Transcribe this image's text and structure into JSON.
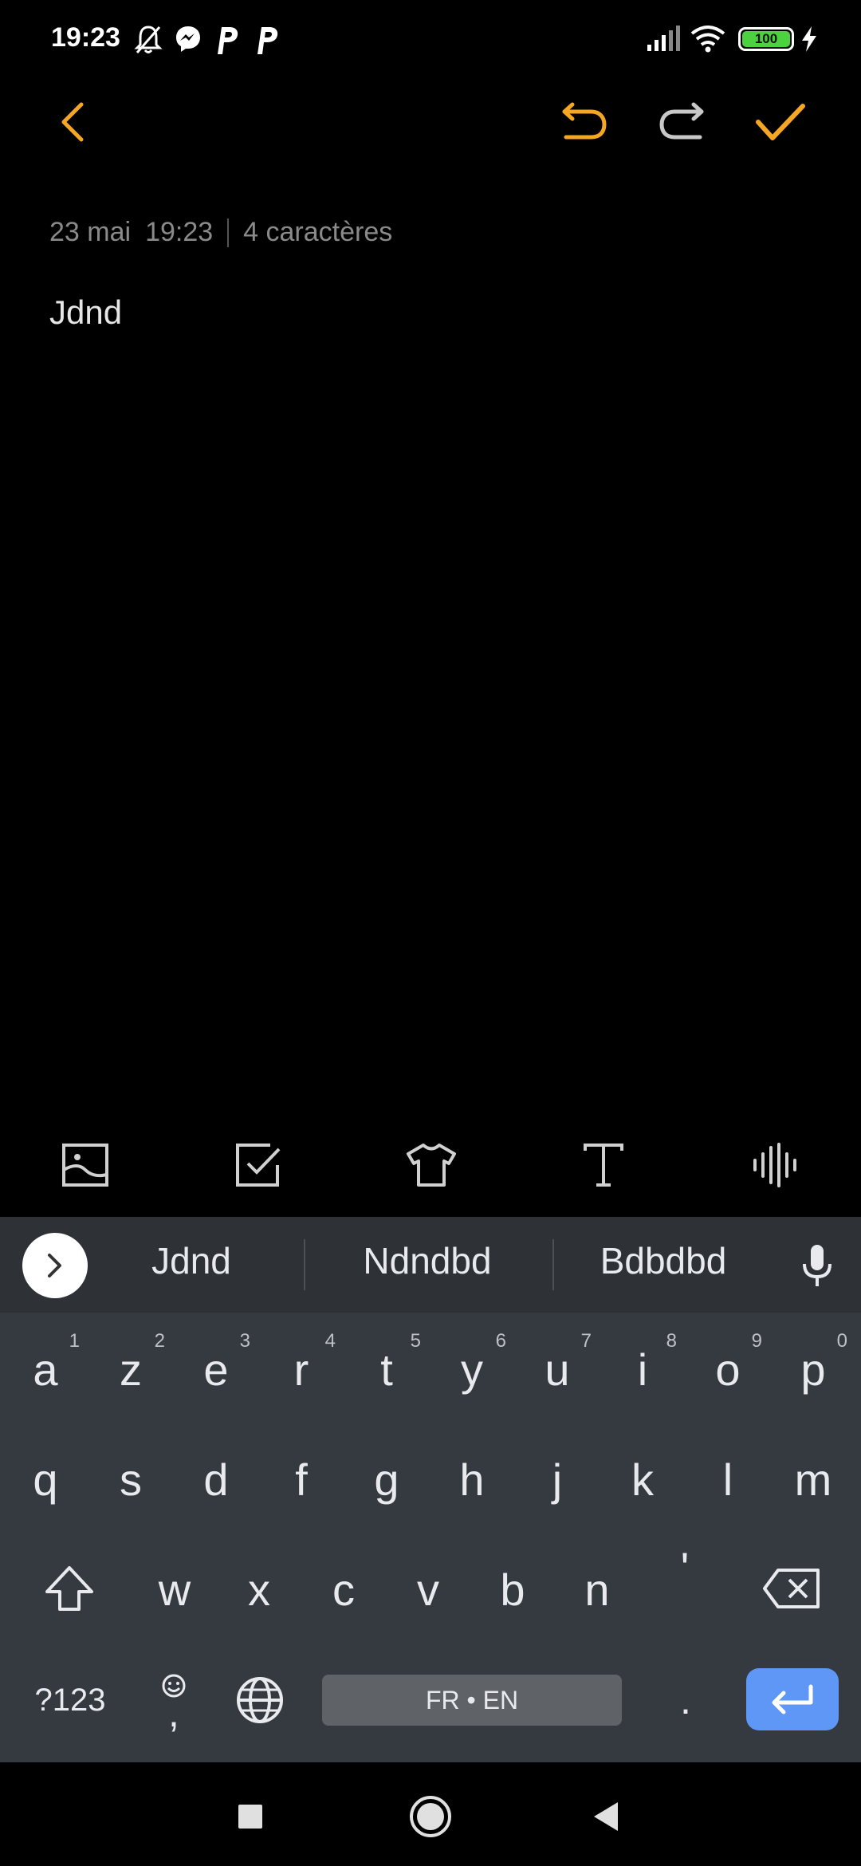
{
  "status_bar": {
    "time": "19:23",
    "battery": "100",
    "icons": [
      "bell-off-icon",
      "messenger-icon",
      "p-app-icon",
      "p-app-icon",
      "signal-icon",
      "wifi-icon",
      "battery-icon",
      "charging-icon"
    ]
  },
  "accent_color": "#f5a623",
  "top_bar": {
    "icons": [
      "back-arrow-icon",
      "undo-icon",
      "redo-icon",
      "check-icon"
    ]
  },
  "note": {
    "date": "23 mai",
    "time": "19:23",
    "char_count": "4 caractères",
    "body": "Jdnd"
  },
  "format_toolbar": {
    "icons": [
      "image-icon",
      "checklist-icon",
      "theme-shirt-icon",
      "text-format-icon",
      "audio-wave-icon"
    ]
  },
  "keyboard": {
    "suggestions": [
      "Jdnd",
      "Ndndbd",
      "Bdbdbd"
    ],
    "row1": [
      {
        "key": "a",
        "hint": "1"
      },
      {
        "key": "z",
        "hint": "2"
      },
      {
        "key": "e",
        "hint": "3"
      },
      {
        "key": "r",
        "hint": "4"
      },
      {
        "key": "t",
        "hint": "5"
      },
      {
        "key": "y",
        "hint": "6"
      },
      {
        "key": "u",
        "hint": "7"
      },
      {
        "key": "i",
        "hint": "8"
      },
      {
        "key": "o",
        "hint": "9"
      },
      {
        "key": "p",
        "hint": "0"
      }
    ],
    "row2": [
      "q",
      "s",
      "d",
      "f",
      "g",
      "h",
      "j",
      "k",
      "l",
      "m"
    ],
    "row3": [
      "w",
      "x",
      "c",
      "v",
      "b",
      "n",
      "'"
    ],
    "symbols_label": "?123",
    "comma": ",",
    "period": ".",
    "space_label": "FR • EN"
  },
  "nav_bar": {
    "icons": [
      "recents-square-icon",
      "home-circle-icon",
      "back-triangle-icon"
    ]
  }
}
